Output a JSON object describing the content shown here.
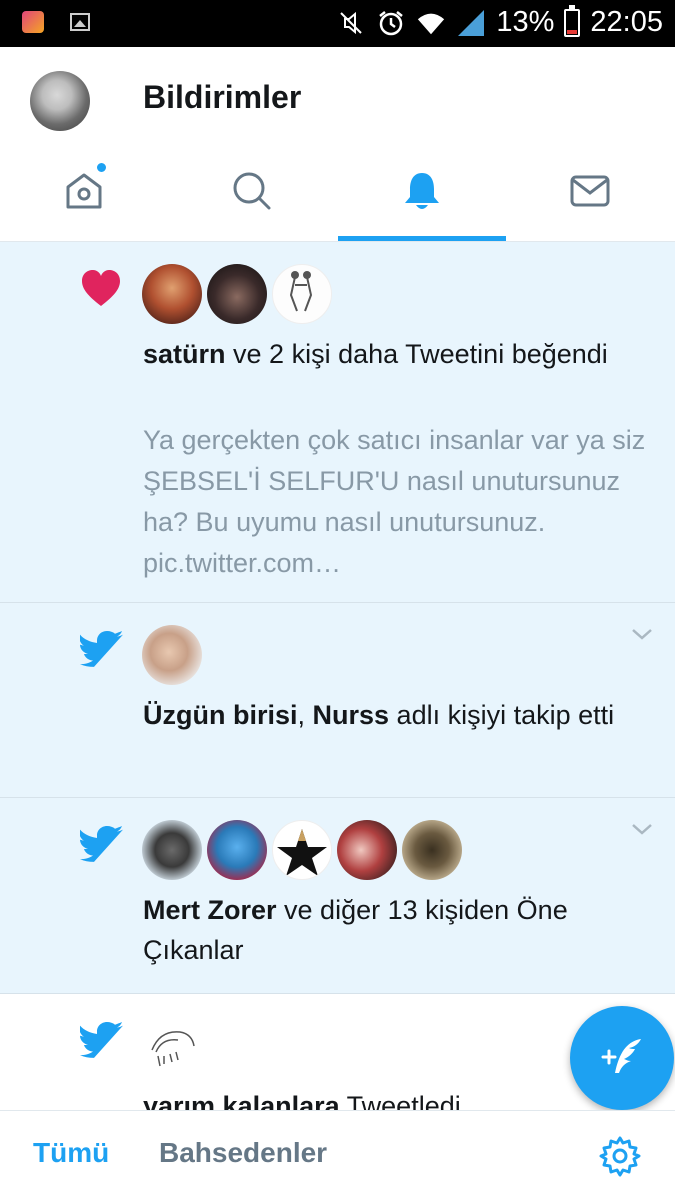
{
  "status_bar": {
    "battery_percent": "13%",
    "time": "22:05",
    "icons": [
      "app-icon",
      "gallery-icon",
      "mute-icon",
      "alarm-icon",
      "wifi-icon",
      "signal-icon",
      "battery-icon"
    ]
  },
  "header": {
    "title": "Bildirimler"
  },
  "tabs": [
    {
      "name": "home",
      "icon": "home-icon",
      "has_dot": true
    },
    {
      "name": "search",
      "icon": "search-icon"
    },
    {
      "name": "notifications",
      "icon": "bell-icon",
      "active": true
    },
    {
      "name": "messages",
      "icon": "mail-icon"
    }
  ],
  "notifications": [
    {
      "type": "like",
      "icon": "heart-icon",
      "user": "satürn",
      "text_rest": " ve 2 kişi daha Tweetini beğendi",
      "tweet_preview": "Ya gerçekten  çok satıcı insanlar var ya siz ŞEBSEL'İ SELFUR'U nasıl unutursunuz ha?   Bu uyumu nasıl unutursunuz. pic.twitter.com…"
    },
    {
      "type": "follow",
      "icon": "twitter-bird-icon",
      "user1": "Üzgün birisi",
      "sep": ", ",
      "user2": "Nurss",
      "text_rest": " adlı kişiyi takip etti"
    },
    {
      "type": "highlights",
      "icon": "twitter-bird-icon",
      "user": "Mert Zorer",
      "text_rest": " ve diğer 13 kişiden Öne Çıkanlar"
    },
    {
      "type": "tweeted",
      "icon": "twitter-bird-icon",
      "user": "yarım kalanlara",
      "text_rest": "  Tweetledi"
    }
  ],
  "bottom_bar": {
    "all_label": "Tümü",
    "mentions_label": "Bahsedenler"
  },
  "colors": {
    "accent": "#1da1f2",
    "like": "#e0245e",
    "unread_bg": "#e8f5fd",
    "secondary_text": "#8899a6"
  }
}
